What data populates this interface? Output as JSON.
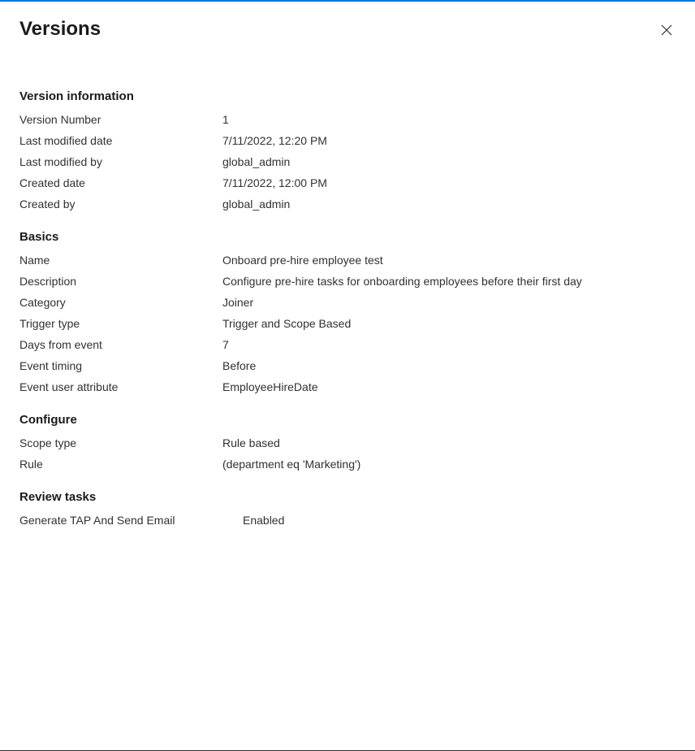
{
  "panel": {
    "title": "Versions"
  },
  "sections": {
    "versionInfo": {
      "title": "Version information",
      "versionNumber": {
        "label": "Version Number",
        "value": "1"
      },
      "lastModifiedDate": {
        "label": "Last modified date",
        "value": "7/11/2022, 12:20 PM"
      },
      "lastModifiedBy": {
        "label": "Last modified by",
        "value": "global_admin"
      },
      "createdDate": {
        "label": "Created date",
        "value": "7/11/2022, 12:00 PM"
      },
      "createdBy": {
        "label": "Created by",
        "value": "global_admin"
      }
    },
    "basics": {
      "title": "Basics",
      "name": {
        "label": "Name",
        "value": "Onboard pre-hire employee test"
      },
      "description": {
        "label": "Description",
        "value": "Configure pre-hire tasks for onboarding employees before their first day"
      },
      "category": {
        "label": "Category",
        "value": "Joiner"
      },
      "triggerType": {
        "label": "Trigger type",
        "value": "Trigger and Scope Based"
      },
      "daysFromEvent": {
        "label": "Days from event",
        "value": "7"
      },
      "eventTiming": {
        "label": "Event timing",
        "value": "Before"
      },
      "eventUserAttribute": {
        "label": "Event user attribute",
        "value": "EmployeeHireDate"
      }
    },
    "configure": {
      "title": "Configure",
      "scopeType": {
        "label": "Scope type",
        "value": "Rule based"
      },
      "rule": {
        "label": "Rule",
        "value": "(department eq 'Marketing')"
      }
    },
    "reviewTasks": {
      "title": "Review tasks",
      "task1": {
        "label": "Generate TAP And Send Email",
        "value": "Enabled"
      }
    }
  }
}
